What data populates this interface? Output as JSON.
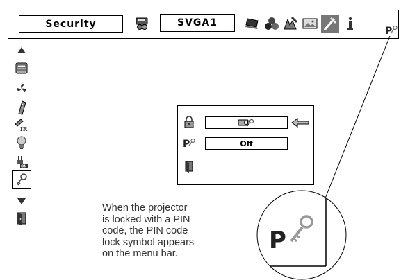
{
  "menu_bar": {
    "title": "Security",
    "input_label": "SVGA1",
    "icons": [
      "input-select-icon",
      "display-icon",
      "color-icon",
      "image-adjust-icon",
      "screen-icon",
      "setting-icon",
      "information-icon",
      "pin-code-lock-icon"
    ]
  },
  "side_menu": {
    "items": [
      "scroll-up-arrow-icon",
      "projector-icon",
      "fan-icon",
      "remote-icon",
      "remote-ir-icon",
      "lamp-icon",
      "power-on-icon",
      "key-security-icon",
      "scroll-down-arrow-icon",
      "exit-door-icon"
    ],
    "selected": "key-security-icon"
  },
  "security_panel": {
    "rows": [
      {
        "icon": "padlock-icon",
        "value": ""
      },
      {
        "icon": "pin-code-lock-icon",
        "value": "Off"
      },
      {
        "icon": "exit-door-icon",
        "value": ""
      }
    ]
  },
  "caption": "When the projector\nis locked with a PIN\ncode, the PIN code\nlock symbol appears\non the menu bar."
}
